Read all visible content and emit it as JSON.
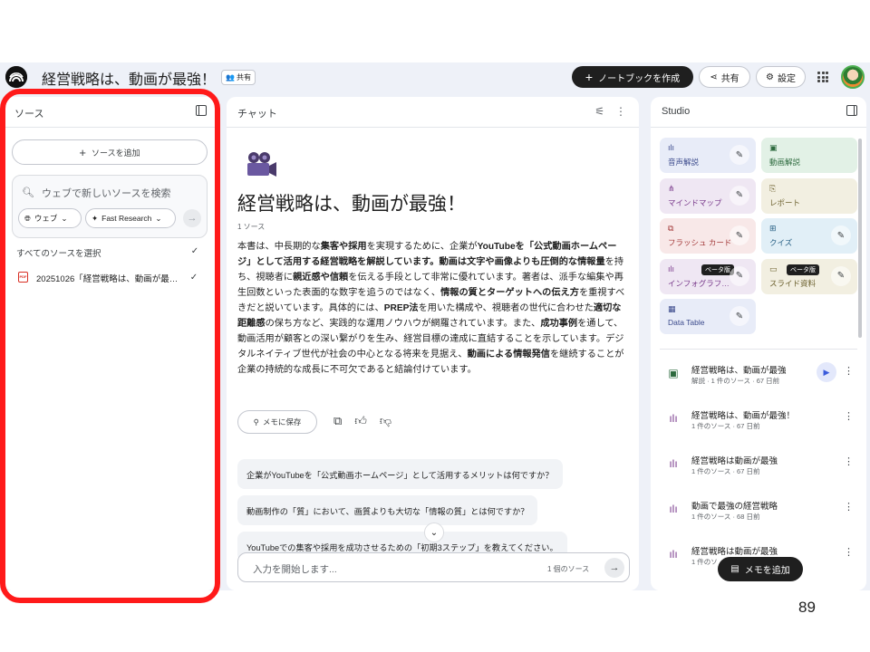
{
  "topbar": {
    "notebook_title": "経営戦略は、動画が最強！",
    "share_chip_label": "共有",
    "create_notebook_label": "ノートブックを作成",
    "share_label": "共有",
    "settings_label": "設定"
  },
  "source_panel": {
    "title": "ソース",
    "add_source_label": "ソースを追加",
    "search_placeholder": "ウェブで新しいソースを検索",
    "web_chip_label": "ウェブ",
    "fast_research_label": "Fast Research",
    "select_all_label": "すべてのソースを選択",
    "sources": [
      {
        "name": "20251026「経営戦略は、動画が最…",
        "type_icon": "pdf-icon",
        "checked": true
      }
    ]
  },
  "chat_panel": {
    "title": "チャット",
    "heading": "経営戦略は、動画が最強！",
    "source_count": "1 ソース",
    "summary": [
      {
        "text": "本書は、中長期的な",
        "bold": false
      },
      {
        "text": "集客や採用",
        "bold": true
      },
      {
        "text": "を実現するために、企業が",
        "bold": false
      },
      {
        "text": "YouTubeを「公式動画ホームページ」として活用する経営戦略を解説しています。動画は文字や画像よりも圧倒的な情報量",
        "bold": true
      },
      {
        "text": "を持ち、視聴者に",
        "bold": false
      },
      {
        "text": "親近感や信頼",
        "bold": true
      },
      {
        "text": "を伝える手段として非常に優れています。著者は、派手な編集や再生回数といった表面的な数字を追うのではなく、",
        "bold": false
      },
      {
        "text": "情報の質とターゲットへの伝え方",
        "bold": true
      },
      {
        "text": "を重視すべきだと説いています。具体的には、",
        "bold": false
      },
      {
        "text": "PREP法",
        "bold": true
      },
      {
        "text": "を用いた構成や、視聴者の世代に合わせた",
        "bold": false
      },
      {
        "text": "適切な距離感",
        "bold": true
      },
      {
        "text": "の保ち方など、実践的な運用ノウハウが網羅されています。また、",
        "bold": false
      },
      {
        "text": "成功事例",
        "bold": true
      },
      {
        "text": "を通して、動画活用が顧客との深い繋がりを生み、経営目標の達成に直結することを示しています。デジタルネイティブ世代が社会の中心となる将来を見据え、",
        "bold": false
      },
      {
        "text": "動画による情報発信",
        "bold": true
      },
      {
        "text": "を継続することが企業の持続的な成長に不可欠であると結論付けています。",
        "bold": false
      }
    ],
    "save_note_label": "メモに保存",
    "suggestions": [
      "企業がYouTubeを「公式動画ホームページ」として活用するメリットは何ですか？",
      "動画制作の「質」において、画質よりも大切な「情報の質」とは何ですか？",
      "YouTubeでの集客や採用を成功させるための「初期3ステップ」を教えてください。"
    ],
    "input_placeholder": "入力を開始します...",
    "input_source_count": "1 個のソース"
  },
  "studio_panel": {
    "title": "Studio",
    "tiles": [
      {
        "label": "音声解説",
        "icon": "audio-icon",
        "color": "#e8ecf8",
        "text_color": "#3b4a8c"
      },
      {
        "label": "動画解説",
        "icon": "video-icon",
        "color": "#e2f1e6",
        "text_color": "#2d6a3e"
      },
      {
        "label": "マインドマップ",
        "icon": "mindmap-icon",
        "color": "#efe7f3",
        "text_color": "#7a3b8c"
      },
      {
        "label": "レポート",
        "icon": "report-icon",
        "color": "#f2efe1",
        "text_color": "#6d6230"
      },
      {
        "label": "フラッシュ カード",
        "icon": "flashcard-icon",
        "color": "#f8e8e8",
        "text_color": "#a33a3a"
      },
      {
        "label": "クイズ",
        "icon": "quiz-icon",
        "color": "#e1eff7",
        "text_color": "#2a6286"
      },
      {
        "label": "インフォグラフ…",
        "icon": "infographic-icon",
        "color": "#efe7f3",
        "text_color": "#7a3b8c",
        "badge": "ベータ版"
      },
      {
        "label": "スライド資料",
        "icon": "slides-icon",
        "color": "#f2efe1",
        "text_color": "#6d6230",
        "badge": "ベータ版"
      },
      {
        "label": "Data Table",
        "icon": "datatable-icon",
        "color": "#e8ecf8",
        "text_color": "#3b4a8c"
      }
    ],
    "notes": [
      {
        "title": "経営戦略は、動画が最強",
        "meta": "解説 · 1 件のソース · 67 日前",
        "icon": "video-note-icon",
        "playable": true
      },
      {
        "title": "経営戦略は、動画が最強！",
        "meta": "1 件のソース · 67 日前",
        "icon": "infographic-note-icon",
        "playable": false
      },
      {
        "title": "経営戦略は動画が最強",
        "meta": "1 件のソース · 67 日前",
        "icon": "infographic-note-icon",
        "playable": false
      },
      {
        "title": "動画で最強の経営戦略",
        "meta": "1 件のソース · 68 日前",
        "icon": "infographic-note-icon",
        "playable": false
      },
      {
        "title": "経営戦略は動画が最強",
        "meta": "1 件のソ",
        "icon": "infographic-note-icon",
        "playable": false
      }
    ],
    "add_memo_label": "メモを追加"
  },
  "page_number": "89",
  "colors": {
    "highlight": "#ff1a1a",
    "app_background": "#eef1f8",
    "dark_button": "#1f1f1f"
  }
}
